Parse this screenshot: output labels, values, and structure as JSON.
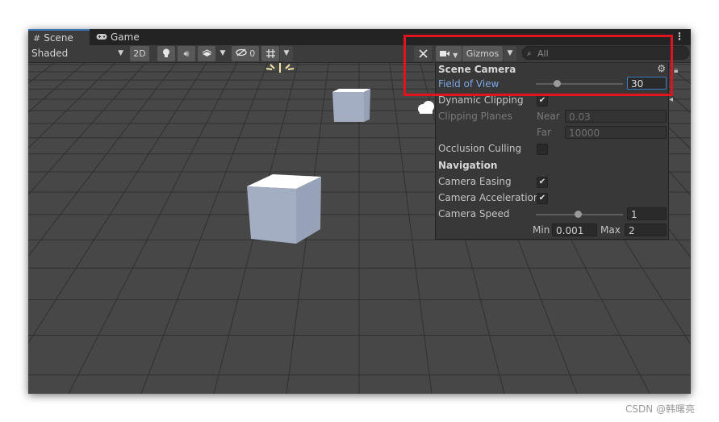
{
  "tabs": {
    "scene_label": "Scene",
    "game_label": "Game",
    "scene_icon": "grid-icon",
    "game_icon": "gamepad-icon"
  },
  "toolbar": {
    "shading_mode": "Shaded",
    "mode_2d_label": "2D",
    "hidden_objects_count": "0",
    "gizmos_label": "Gizmos",
    "search_placeholder": "All",
    "icons": [
      "dropdown-arrow-icon",
      "lightbulb-icon",
      "audio-icon",
      "effects-icon",
      "visibility-icon",
      "grid-snap-icon",
      "tools-icon",
      "camera-icon",
      "search-icon",
      "kebab-menu-icon"
    ]
  },
  "scene_camera_panel": {
    "title": "Scene Camera",
    "field_of_view_label": "Field of View",
    "field_of_view_value": "30",
    "dynamic_clipping_label": "Dynamic Clipping",
    "dynamic_clipping_checked": true,
    "clipping_planes_label": "Clipping Planes",
    "near_label": "Near",
    "near_value": "0.03",
    "far_label": "Far",
    "far_value": "10000",
    "occlusion_culling_label": "Occlusion Culling",
    "occlusion_culling_checked": false,
    "navigation_title": "Navigation",
    "camera_easing_label": "Camera Easing",
    "camera_easing_checked": true,
    "camera_acceleration_label": "Camera Acceleration",
    "camera_acceleration_checked": true,
    "camera_speed_label": "Camera Speed",
    "camera_speed_value": "1",
    "min_label": "Min",
    "min_value": "0.001",
    "max_label": "Max",
    "max_value": "2",
    "checkmark_glyph": "✔"
  },
  "colors": {
    "highlight_border": "#e0141e",
    "accent_blue": "#3a79bb",
    "scene_background": "#474747",
    "cube_side": "#a3aec3",
    "cube_top": "#ffffff"
  },
  "watermark": "CSDN @韩曙亮"
}
